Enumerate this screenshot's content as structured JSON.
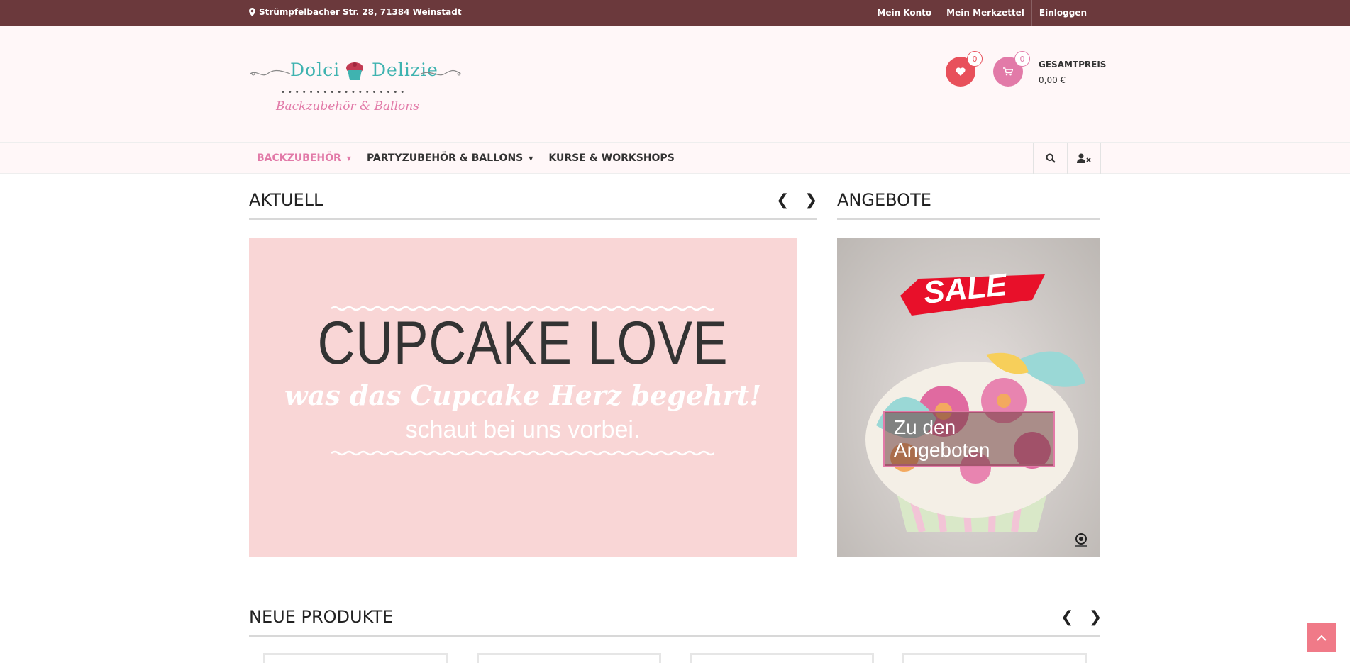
{
  "topbar": {
    "address": "Strümpfelbacher Str. 28, 71384 Weinstadt",
    "links": [
      "Mein Konto",
      "Mein Merkzettel",
      "Einloggen"
    ]
  },
  "header": {
    "logo": {
      "word1": "Dolci",
      "word2": "Delizie",
      "dots": "••••••••••••••••••",
      "tagline": "Backzubehör & Ballons"
    },
    "wishlist_count": "0",
    "cart_count": "0",
    "total_label": "GESAMTPREIS",
    "total_value": "0,00 €"
  },
  "nav": {
    "items": [
      {
        "label": "BACKZUBEHÖR",
        "active": true,
        "dropdown": true
      },
      {
        "label": "PARTYZUBEHÖR & BALLONS",
        "active": false,
        "dropdown": true
      },
      {
        "label": "KURSE & WORKSHOPS",
        "active": false,
        "dropdown": false
      }
    ],
    "tools": [
      "search-icon",
      "user-times-icon"
    ]
  },
  "aktuell": {
    "title": "AKTUELL",
    "banner": {
      "headline": "CUPCAKE LOVE",
      "script": "was das Cupcake Herz begehrt!",
      "line": "schaut bei uns vorbei."
    }
  },
  "angebote": {
    "title": "ANGEBOTE",
    "sale": "SALE",
    "cta": "Zu den Angeboten"
  },
  "neue": {
    "title": "NEUE PRODUKTE"
  },
  "arrows": {
    "prev": "❮",
    "next": "❯"
  },
  "colors": {
    "topbar": "#6b393c",
    "accent_pink": "#e27aa8",
    "wish_red": "#e8505b",
    "teal": "#3fb3b0",
    "banner_bg": "#f9d6d6",
    "to_top": "#f07a88"
  }
}
